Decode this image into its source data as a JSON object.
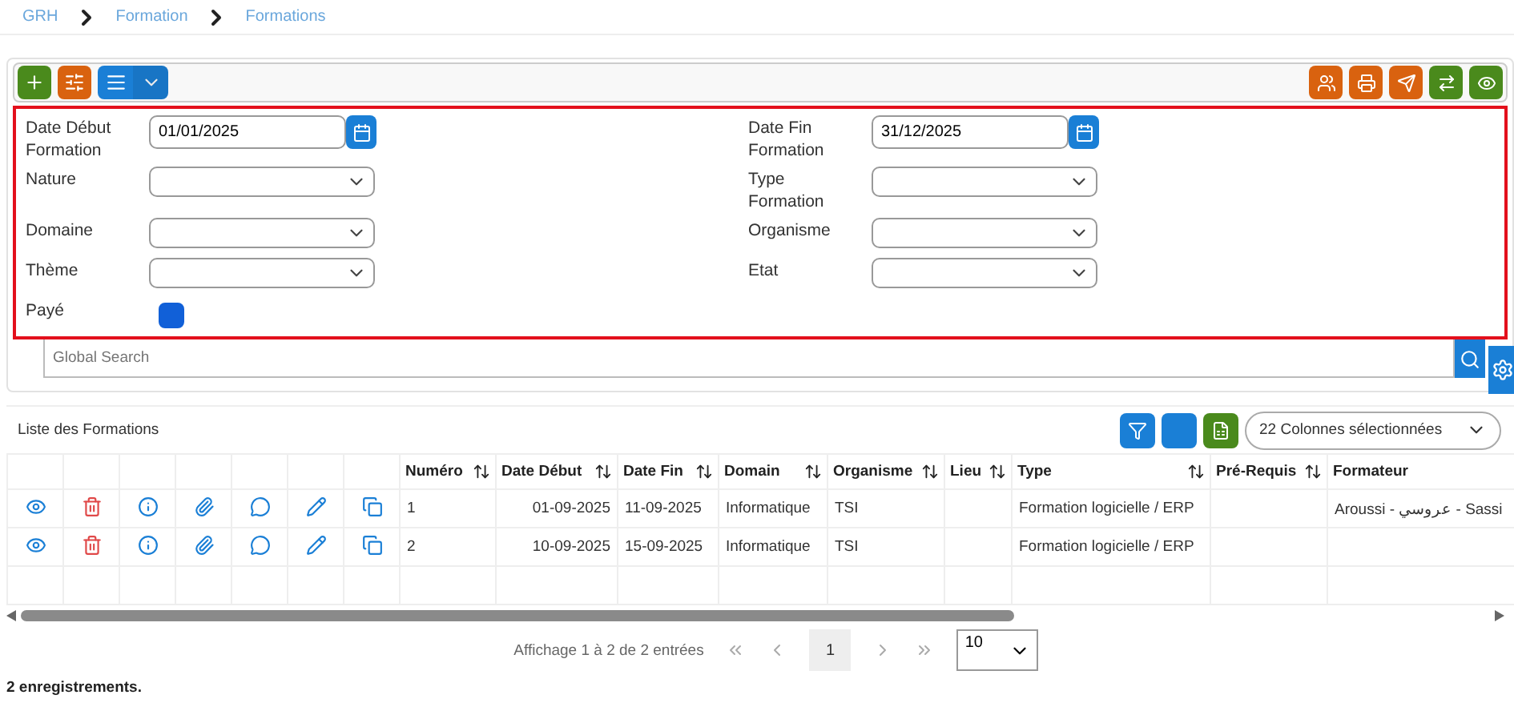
{
  "breadcrumb": [
    "GRH",
    "Formation",
    "Formations"
  ],
  "toolbar": {
    "left": [
      {
        "color": "#4a8a1c"
      },
      {
        "color": "#d9620f"
      },
      {
        "color": "#1a7fd6"
      }
    ],
    "right": [
      {
        "color": "#d9620f"
      },
      {
        "color": "#d9620f"
      },
      {
        "color": "#d9620f"
      },
      {
        "color": "#4a8a1c"
      },
      {
        "color": "#4a8a1c"
      }
    ]
  },
  "filters": [
    {
      "kind": "date",
      "label": "Date Début Formation",
      "value": "01/01/2025"
    },
    {
      "kind": "date",
      "label": "Date Fin Formation",
      "value": "31/12/2025"
    },
    {
      "kind": "select",
      "label": "Nature"
    },
    {
      "kind": "select",
      "label": "Type Formation"
    },
    {
      "kind": "select",
      "label": "Domaine"
    },
    {
      "kind": "select",
      "label": "Organisme"
    },
    {
      "kind": "select",
      "label": "Thème"
    },
    {
      "kind": "select",
      "label": "Etat"
    },
    {
      "kind": "checkbox",
      "label": "Payé",
      "checked": true
    }
  ],
  "search": {
    "placeholder": "Global Search"
  },
  "list": {
    "title": "Liste des Formations",
    "columns_selector": "22 Colonnes sélectionnées"
  },
  "table": {
    "columns": [
      "Numéro",
      "Date Début",
      "Date Fin",
      "Domain",
      "Organisme",
      "Lieu",
      "Type",
      "Pré-Requis",
      "Formateur"
    ],
    "rows": [
      {
        "cells": [
          "1",
          "01-09-2025",
          "11-09-2025",
          "Informatique",
          "TSI",
          "",
          "Formation logicielle / ERP",
          "",
          "Aroussi - عروسي - Sassi"
        ]
      },
      {
        "cells": [
          "2",
          "10-09-2025",
          "15-09-2025",
          "Informatique",
          "TSI",
          "",
          "Formation logicielle / ERP",
          "",
          ""
        ]
      }
    ]
  },
  "pagination": {
    "summary": "Affichage 1 à 2 de 2 entrées",
    "pages": [
      {
        "label": "1",
        "selected": true
      }
    ],
    "page_size": "10"
  },
  "status": "2 enregistrements."
}
